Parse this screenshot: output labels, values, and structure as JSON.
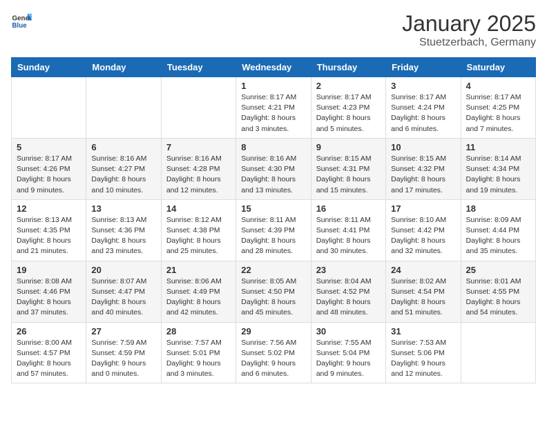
{
  "header": {
    "logo_general": "General",
    "logo_blue": "Blue",
    "month": "January 2025",
    "location": "Stuetzerbach, Germany"
  },
  "weekdays": [
    "Sunday",
    "Monday",
    "Tuesday",
    "Wednesday",
    "Thursday",
    "Friday",
    "Saturday"
  ],
  "weeks": [
    [
      {
        "day": "",
        "info": ""
      },
      {
        "day": "",
        "info": ""
      },
      {
        "day": "",
        "info": ""
      },
      {
        "day": "1",
        "info": "Sunrise: 8:17 AM\nSunset: 4:21 PM\nDaylight: 8 hours\nand 3 minutes."
      },
      {
        "day": "2",
        "info": "Sunrise: 8:17 AM\nSunset: 4:23 PM\nDaylight: 8 hours\nand 5 minutes."
      },
      {
        "day": "3",
        "info": "Sunrise: 8:17 AM\nSunset: 4:24 PM\nDaylight: 8 hours\nand 6 minutes."
      },
      {
        "day": "4",
        "info": "Sunrise: 8:17 AM\nSunset: 4:25 PM\nDaylight: 8 hours\nand 7 minutes."
      }
    ],
    [
      {
        "day": "5",
        "info": "Sunrise: 8:17 AM\nSunset: 4:26 PM\nDaylight: 8 hours\nand 9 minutes."
      },
      {
        "day": "6",
        "info": "Sunrise: 8:16 AM\nSunset: 4:27 PM\nDaylight: 8 hours\nand 10 minutes."
      },
      {
        "day": "7",
        "info": "Sunrise: 8:16 AM\nSunset: 4:28 PM\nDaylight: 8 hours\nand 12 minutes."
      },
      {
        "day": "8",
        "info": "Sunrise: 8:16 AM\nSunset: 4:30 PM\nDaylight: 8 hours\nand 13 minutes."
      },
      {
        "day": "9",
        "info": "Sunrise: 8:15 AM\nSunset: 4:31 PM\nDaylight: 8 hours\nand 15 minutes."
      },
      {
        "day": "10",
        "info": "Sunrise: 8:15 AM\nSunset: 4:32 PM\nDaylight: 8 hours\nand 17 minutes."
      },
      {
        "day": "11",
        "info": "Sunrise: 8:14 AM\nSunset: 4:34 PM\nDaylight: 8 hours\nand 19 minutes."
      }
    ],
    [
      {
        "day": "12",
        "info": "Sunrise: 8:13 AM\nSunset: 4:35 PM\nDaylight: 8 hours\nand 21 minutes."
      },
      {
        "day": "13",
        "info": "Sunrise: 8:13 AM\nSunset: 4:36 PM\nDaylight: 8 hours\nand 23 minutes."
      },
      {
        "day": "14",
        "info": "Sunrise: 8:12 AM\nSunset: 4:38 PM\nDaylight: 8 hours\nand 25 minutes."
      },
      {
        "day": "15",
        "info": "Sunrise: 8:11 AM\nSunset: 4:39 PM\nDaylight: 8 hours\nand 28 minutes."
      },
      {
        "day": "16",
        "info": "Sunrise: 8:11 AM\nSunset: 4:41 PM\nDaylight: 8 hours\nand 30 minutes."
      },
      {
        "day": "17",
        "info": "Sunrise: 8:10 AM\nSunset: 4:42 PM\nDaylight: 8 hours\nand 32 minutes."
      },
      {
        "day": "18",
        "info": "Sunrise: 8:09 AM\nSunset: 4:44 PM\nDaylight: 8 hours\nand 35 minutes."
      }
    ],
    [
      {
        "day": "19",
        "info": "Sunrise: 8:08 AM\nSunset: 4:46 PM\nDaylight: 8 hours\nand 37 minutes."
      },
      {
        "day": "20",
        "info": "Sunrise: 8:07 AM\nSunset: 4:47 PM\nDaylight: 8 hours\nand 40 minutes."
      },
      {
        "day": "21",
        "info": "Sunrise: 8:06 AM\nSunset: 4:49 PM\nDaylight: 8 hours\nand 42 minutes."
      },
      {
        "day": "22",
        "info": "Sunrise: 8:05 AM\nSunset: 4:50 PM\nDaylight: 8 hours\nand 45 minutes."
      },
      {
        "day": "23",
        "info": "Sunrise: 8:04 AM\nSunset: 4:52 PM\nDaylight: 8 hours\nand 48 minutes."
      },
      {
        "day": "24",
        "info": "Sunrise: 8:02 AM\nSunset: 4:54 PM\nDaylight: 8 hours\nand 51 minutes."
      },
      {
        "day": "25",
        "info": "Sunrise: 8:01 AM\nSunset: 4:55 PM\nDaylight: 8 hours\nand 54 minutes."
      }
    ],
    [
      {
        "day": "26",
        "info": "Sunrise: 8:00 AM\nSunset: 4:57 PM\nDaylight: 8 hours\nand 57 minutes."
      },
      {
        "day": "27",
        "info": "Sunrise: 7:59 AM\nSunset: 4:59 PM\nDaylight: 9 hours\nand 0 minutes."
      },
      {
        "day": "28",
        "info": "Sunrise: 7:57 AM\nSunset: 5:01 PM\nDaylight: 9 hours\nand 3 minutes."
      },
      {
        "day": "29",
        "info": "Sunrise: 7:56 AM\nSunset: 5:02 PM\nDaylight: 9 hours\nand 6 minutes."
      },
      {
        "day": "30",
        "info": "Sunrise: 7:55 AM\nSunset: 5:04 PM\nDaylight: 9 hours\nand 9 minutes."
      },
      {
        "day": "31",
        "info": "Sunrise: 7:53 AM\nSunset: 5:06 PM\nDaylight: 9 hours\nand 12 minutes."
      },
      {
        "day": "",
        "info": ""
      }
    ]
  ]
}
